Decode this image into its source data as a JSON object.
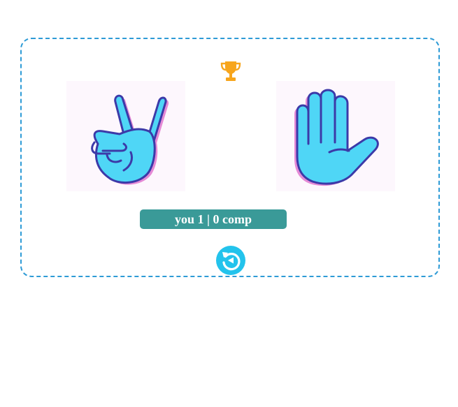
{
  "scoreboard": {
    "you_label": "you",
    "you_score": "1",
    "separator": "|",
    "comp_score": "0",
    "comp_label": "comp"
  },
  "player_choice": {
    "icon": "victory-hand-scissors-icon"
  },
  "computer_choice": {
    "icon": "open-hand-paper-icon"
  },
  "trophy": {
    "icon": "trophy-icon",
    "color": "#f7a51c"
  },
  "restart": {
    "icon": "restart-icon",
    "color": "#23c3ec"
  },
  "colors": {
    "border": "#2e9bd6",
    "score_bg": "#3a9a98",
    "hand_fill": "#4fd6f6",
    "hand_shadow": "#e58ad6",
    "hand_outline": "#3c3aa8"
  }
}
